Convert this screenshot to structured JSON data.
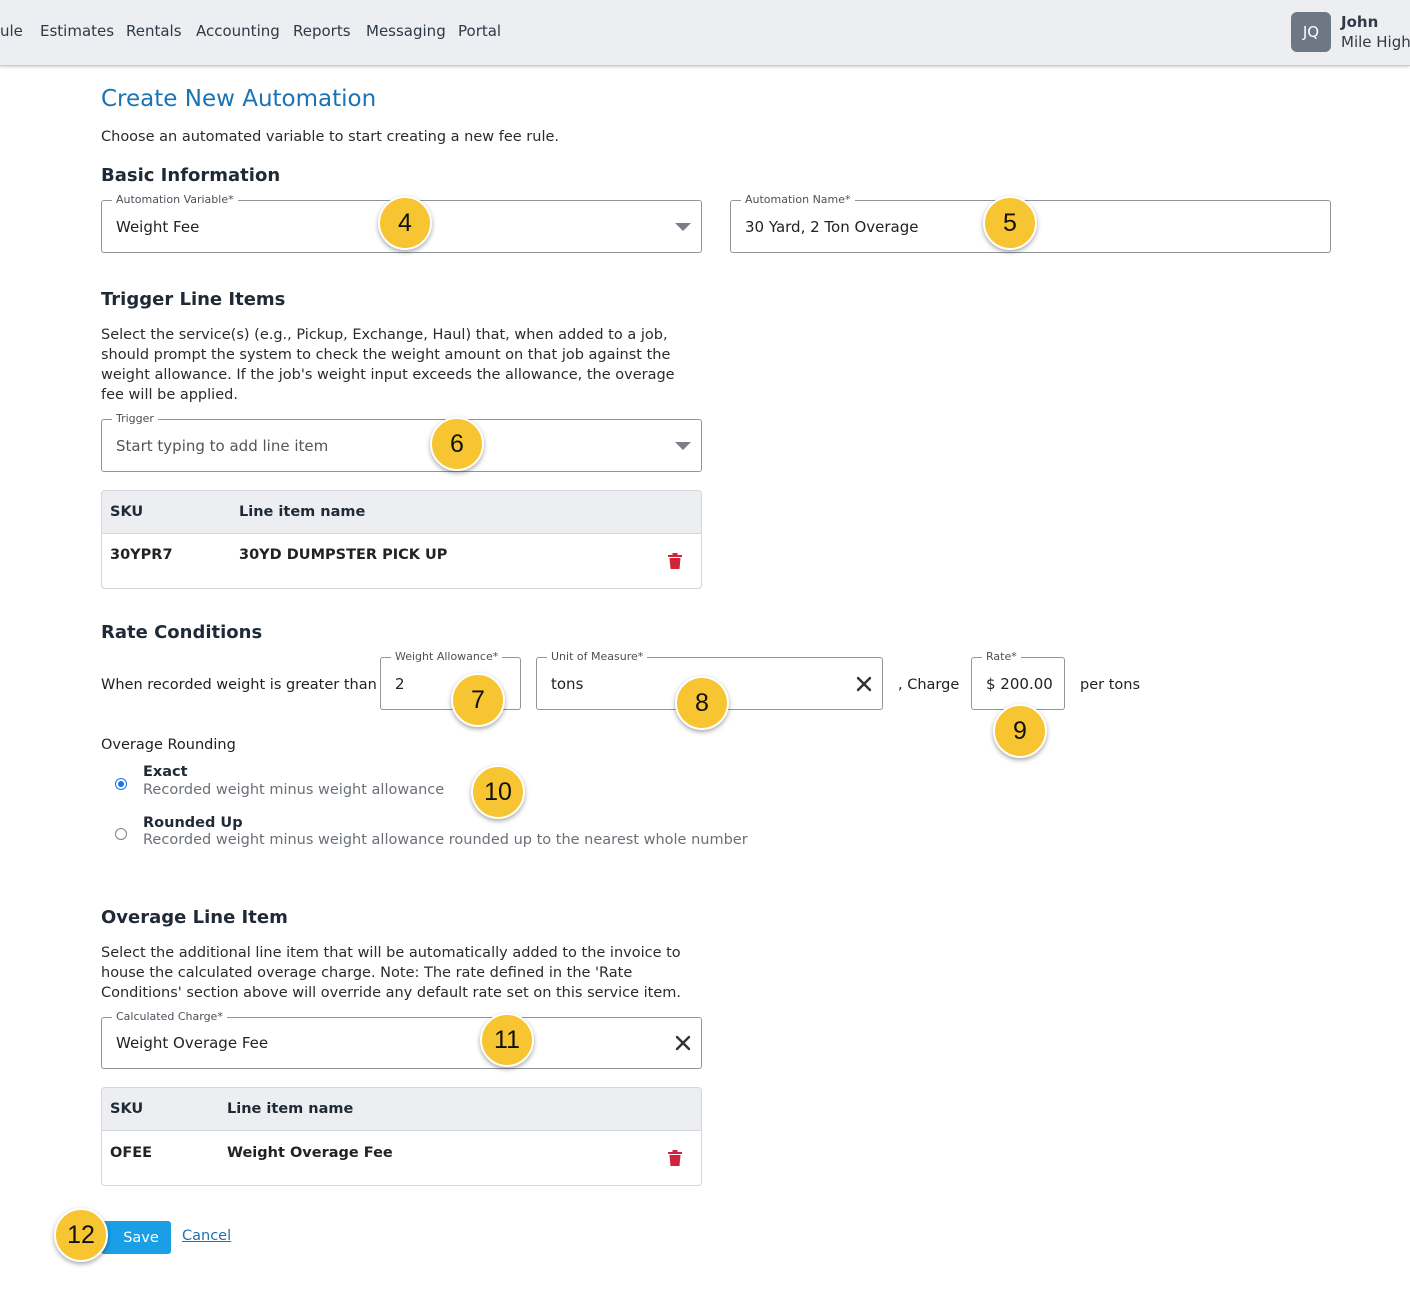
{
  "nav": {
    "items": [
      "ule",
      "Estimates",
      "Rentals",
      "Accounting",
      "Reports",
      "Messaging",
      "Portal"
    ],
    "user": {
      "initials": "JQ",
      "name": "John",
      "company": "Mile High"
    }
  },
  "page": {
    "title": "Create New Automation",
    "subtitle": "Choose an automated variable to start creating a new fee rule."
  },
  "basic_info": {
    "heading": "Basic Information",
    "automation_variable": {
      "label": "Automation Variable*",
      "value": "Weight Fee"
    },
    "automation_name": {
      "label": "Automation Name*",
      "value": "30 Yard, 2 Ton Overage"
    }
  },
  "trigger": {
    "heading": "Trigger Line Items",
    "description": "Select the service(s) (e.g., Pickup, Exchange, Haul) that, when added to a job, should prompt the system to check the weight amount on that job against the weight allowance. If the job's weight input exceeds the allowance, the overage fee will be applied.",
    "field": {
      "label": "Trigger",
      "placeholder": "Start typing to add line item"
    },
    "table": {
      "headers": [
        "SKU",
        "Line item name"
      ],
      "rows": [
        {
          "sku": "30YPR7",
          "name": "30YD DUMPSTER PICK UP"
        }
      ]
    }
  },
  "rate_conditions": {
    "heading": "Rate Conditions",
    "prefix": "When recorded weight is greater than",
    "weight_allowance": {
      "label": "Weight Allowance*",
      "value": "2"
    },
    "unit_of_measure": {
      "label": "Unit of Measure*",
      "value": "tons"
    },
    "charge_text": ", Charge",
    "rate": {
      "label": "Rate*",
      "value": "$ 200.00"
    },
    "suffix": "per tons"
  },
  "overage_rounding": {
    "heading": "Overage Rounding",
    "options": [
      {
        "title": "Exact",
        "description": "Recorded weight minus weight allowance",
        "selected": true
      },
      {
        "title": "Rounded Up",
        "description": "Recorded weight minus weight allowance rounded up to the nearest whole number",
        "selected": false
      }
    ]
  },
  "overage_line_item": {
    "heading": "Overage Line Item",
    "description": "Select the additional line item that will be automatically added to the invoice to house the calculated overage charge. Note: The rate defined in the 'Rate Conditions' section above will override any default rate set on this service item.",
    "field": {
      "label": "Calculated Charge*",
      "value": "Weight Overage Fee"
    },
    "table": {
      "headers": [
        "SKU",
        "Line item name"
      ],
      "rows": [
        {
          "sku": "OFEE",
          "name": "Weight Overage Fee"
        }
      ]
    }
  },
  "actions": {
    "save": "Save",
    "cancel": "Cancel"
  },
  "callouts": [
    "4",
    "5",
    "6",
    "7",
    "8",
    "9",
    "10",
    "11",
    "12"
  ],
  "colors": {
    "accent": "#1a73b5",
    "button": "#1a9ee6",
    "callout": "#f7c531",
    "delete": "#d0243a"
  }
}
